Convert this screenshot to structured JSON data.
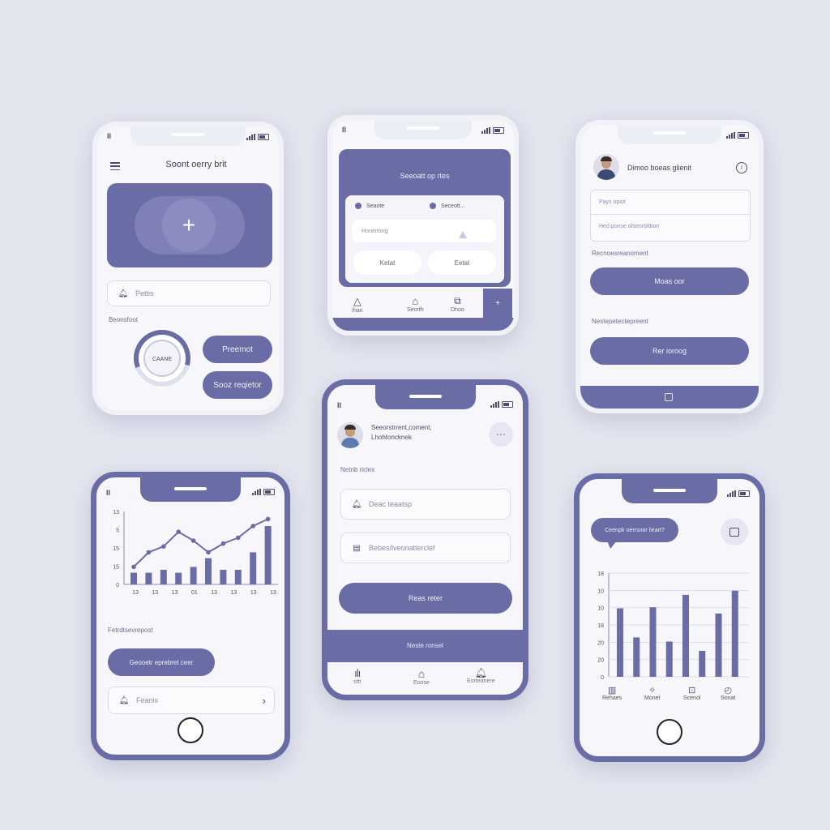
{
  "phone1": {
    "status_left": "II",
    "header_title": "Soont oerry brit",
    "add_symbol": "+",
    "search_placeholder": "Pettis",
    "section_label": "Beonsfoot",
    "ring_label": "CAANE",
    "button_primary": "Preemot",
    "button_secondary": "Sooz reqietor"
  },
  "phone2": {
    "status_left": "II",
    "card_title": "Seeoatt op rtes",
    "radio_1": "Seaote",
    "radio_2": "Seceott...",
    "input_placeholder": "Honemorg",
    "chip_1": "Ketat",
    "chip_2": "Eetat",
    "nav_1": "Ihan",
    "nav_2": "Seorth",
    "nav_3": "Dhoo",
    "nav_add": "+"
  },
  "phone3": {
    "profile_name": "Dimoo boeas glienit",
    "field_1": "Pays opiot",
    "field_2": "Hed ponse ofseorbitbon",
    "section_1": "Recnoesreanoment",
    "button_1": "Moas oor",
    "section_2": "Nestepetectepreent",
    "button_2": "Rer ioroog"
  },
  "phone4": {
    "status_left": "II",
    "profile_line_1": "Seeorstrrent,coment,",
    "profile_line_2": "Lhohtoncknek",
    "section_label": "Netnb riclex",
    "field_1": "Deac teaatsp",
    "field_2": "Bebes/lveonatterclef",
    "primary_button": "Reas reter",
    "banner_label": "Neste ronsel",
    "nav_1": "sttt",
    "nav_2": "Eoose",
    "nav_3": "Eorteanere"
  },
  "phone5": {
    "status_left": "II",
    "section_label": "Fetrdtsevrepost",
    "action_button": "Geooetr eprebret ceer",
    "list_item": "Feanis",
    "list_item_chevron": "›"
  },
  "phone6": {
    "bubble_text": "Ceenplr oerrsnor lieart?",
    "nav_1": "Rehaes",
    "nav_2": "Monet",
    "nav_3": "Scenol",
    "nav_4": "Sonat"
  },
  "colors": {
    "accent": "#6a6ca6",
    "background": "#e3e5ef",
    "screen": "#f7f7fb"
  },
  "chart_data": [
    {
      "type": "bar",
      "y_tick_labels": [
        "0",
        "15",
        "15",
        "5",
        "13"
      ],
      "x_tick_labels": [
        "13",
        "13",
        "13",
        "01",
        "13",
        "13",
        "13",
        "13"
      ],
      "bars": [
        0.2,
        0.2,
        0.25,
        0.2,
        0.3,
        0.45,
        0.25,
        0.25,
        0.55,
        1.0
      ],
      "line": [
        0.3,
        0.55,
        0.65,
        0.9,
        0.75,
        0.55,
        0.7,
        0.8,
        1.0,
        1.12
      ]
    },
    {
      "type": "bar",
      "y_tick_labels": [
        "0",
        "20",
        "20",
        "18",
        "10",
        "10",
        "18"
      ],
      "bars": [
        0.66,
        0.38,
        0.67,
        0.34,
        0.79,
        0.25,
        0.61,
        0.83
      ]
    }
  ]
}
